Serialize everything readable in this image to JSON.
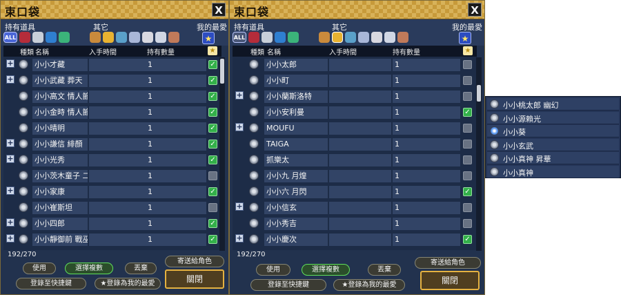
{
  "left_window": {
    "title": "束口袋",
    "close_label": "X",
    "tabs": {
      "owned": "持有道具",
      "other": "其它",
      "favorite": "我的最愛"
    },
    "all_label": "ALL",
    "headers": {
      "type": "種類",
      "name": "名稱",
      "date": "入手時間",
      "qty": "持有數量",
      "star": "★"
    },
    "rows": [
      {
        "name": "小小才藏",
        "qty": "1",
        "expand": true,
        "fav": true
      },
      {
        "name": "小小武藏 葬天",
        "qty": "1",
        "expand": true,
        "fav": true
      },
      {
        "name": "小小高文 情人節",
        "qty": "1",
        "expand": false,
        "fav": true
      },
      {
        "name": "小小金時 情人節",
        "qty": "1",
        "expand": false,
        "fav": true
      },
      {
        "name": "小小晴明",
        "qty": "1",
        "expand": false,
        "fav": true
      },
      {
        "name": "小小謙信 緋顏",
        "qty": "1",
        "expand": true,
        "fav": true
      },
      {
        "name": "小小光秀",
        "qty": "1",
        "expand": true,
        "fav": true
      },
      {
        "name": "小小茨木童子 二代目",
        "qty": "1",
        "expand": false,
        "fav": false
      },
      {
        "name": "小小家康",
        "qty": "1",
        "expand": true,
        "fav": true
      },
      {
        "name": "小小崔斯坦",
        "qty": "1",
        "expand": false,
        "fav": false
      },
      {
        "name": "小小四郎",
        "qty": "1",
        "expand": true,
        "fav": true
      },
      {
        "name": "小小靜御前 戰巫女",
        "qty": "1",
        "expand": true,
        "fav": true
      }
    ],
    "capacity": "192/270",
    "buttons": {
      "use": "使用",
      "multi": "選擇複數",
      "discard": "丟棄",
      "send": "寄送給角色",
      "shortcut": "登錄至快捷鍵",
      "favorite": "★登錄為我的最愛",
      "close": "關閉"
    }
  },
  "right_window": {
    "title": "束口袋",
    "close_label": "X",
    "tabs": {
      "owned": "持有道具",
      "other": "其它",
      "favorite": "我的最愛"
    },
    "all_label": "ALL",
    "headers": {
      "type": "種類",
      "name": "名稱",
      "date": "入手時間",
      "qty": "持有數量",
      "star": "★"
    },
    "rows": [
      {
        "name": "小小太郎",
        "qty": "1",
        "expand": false,
        "fav": false
      },
      {
        "name": "小小町",
        "qty": "1",
        "expand": false,
        "fav": false
      },
      {
        "name": "小小蘭斯洛特",
        "qty": "1",
        "expand": true,
        "fav": false
      },
      {
        "name": "小小安利曼",
        "qty": "1",
        "expand": false,
        "fav": true
      },
      {
        "name": "MOUFU",
        "qty": "1",
        "expand": true,
        "fav": false
      },
      {
        "name": "TAIGA",
        "qty": "1",
        "expand": false,
        "fav": false
      },
      {
        "name": "抓樂太",
        "qty": "1",
        "expand": false,
        "fav": false
      },
      {
        "name": "小小九 月煌",
        "qty": "1",
        "expand": false,
        "fav": false
      },
      {
        "name": "小小六 月閃",
        "qty": "1",
        "expand": false,
        "fav": true
      },
      {
        "name": "小小信玄",
        "qty": "1",
        "expand": true,
        "fav": false
      },
      {
        "name": "小小秀吉",
        "qty": "1",
        "expand": false,
        "fav": false
      },
      {
        "name": "小小慶次",
        "qty": "1",
        "expand": true,
        "fav": true
      }
    ],
    "capacity": "192/270",
    "buttons": {
      "use": "使用",
      "multi": "選擇複數",
      "discard": "丟棄",
      "send": "寄送給角色",
      "shortcut": "登錄至快捷鍵",
      "favorite": "★登錄為我的最愛",
      "close": "關閉"
    }
  },
  "popup": {
    "items": [
      {
        "name": "小小桃太郎 幽幻",
        "icon": "silver"
      },
      {
        "name": "小小源賴光",
        "icon": "silver"
      },
      {
        "name": "小小葵",
        "icon": "blue"
      },
      {
        "name": "小小玄武",
        "icon": "silver"
      },
      {
        "name": "小小真神 昇華",
        "icon": "silver"
      },
      {
        "name": "小小真神",
        "icon": "silver"
      }
    ]
  },
  "colors": {
    "frame": "#22324e",
    "title_gold": "#c79a3a",
    "check_green": "#33b04a",
    "accent_green": "#61e05b"
  }
}
